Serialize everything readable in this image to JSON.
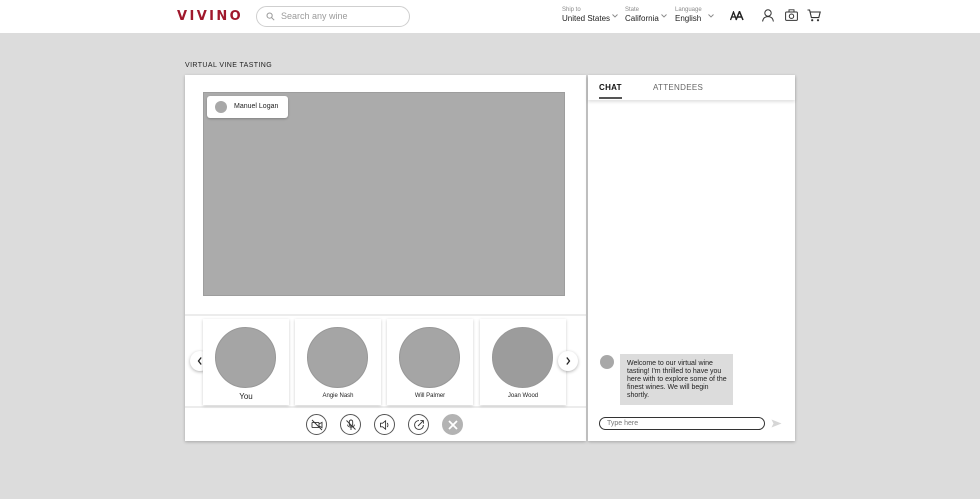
{
  "header": {
    "logo": "VIVINO",
    "search_placeholder": "Search any wine",
    "ship_to": {
      "label": "Ship to",
      "value": "United States"
    },
    "state": {
      "label": "State",
      "value": "California"
    },
    "language": {
      "label": "Language",
      "value": "English"
    },
    "icons": [
      "text-size-icon",
      "user-icon",
      "camera-icon",
      "cart-icon"
    ]
  },
  "page": {
    "title": "VIRTUAL VINE TASTING"
  },
  "video": {
    "presenter_name": "Manuel Logan"
  },
  "participants": [
    {
      "name": "You"
    },
    {
      "name": "Angie Nash"
    },
    {
      "name": "Will Palmer"
    },
    {
      "name": "Joan Wood"
    }
  ],
  "controls": [
    "video-off-icon",
    "mic-off-icon",
    "speaker-icon",
    "share-icon",
    "end-call-icon"
  ],
  "chat": {
    "tabs": [
      {
        "label": "CHAT",
        "active": true
      },
      {
        "label": "ATTENDEES",
        "active": false
      }
    ],
    "messages": [
      {
        "text": "Welcome to our virtual wine tasting! I'm thrilled to have you here with to explore some of the finest wines. We will begin shortly."
      }
    ],
    "input_placeholder": "Type here"
  },
  "colors": {
    "brand": "#a0182c",
    "background": "#dcdcdc"
  }
}
